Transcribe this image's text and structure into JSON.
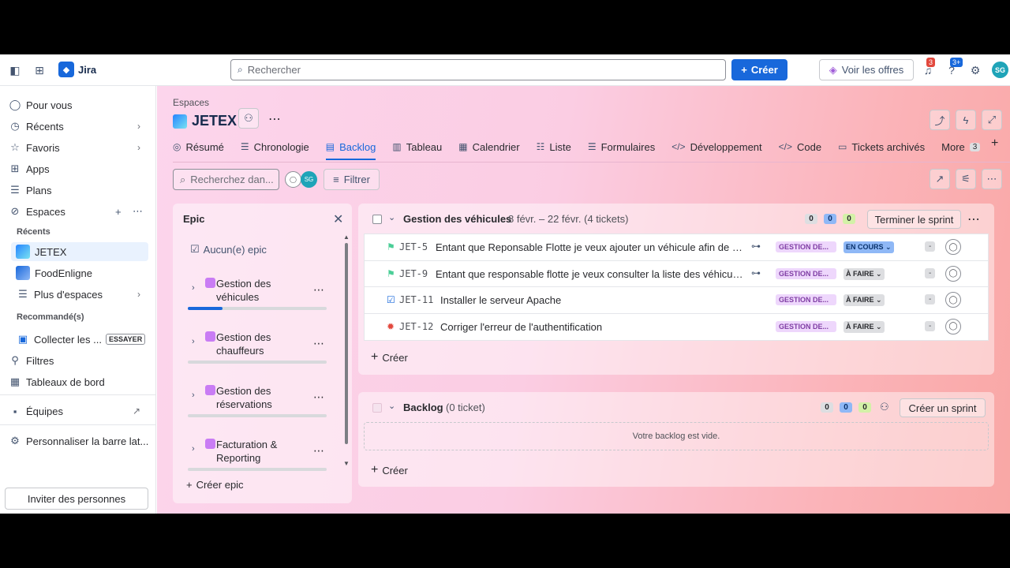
{
  "topbar": {
    "app_name": "Jira",
    "search_placeholder": "Rechercher",
    "create_label": "Créer",
    "offers_label": "Voir les offres",
    "notif_count": "3",
    "help_count": "3+",
    "avatar_initials": "SG"
  },
  "sidebar": {
    "for_you": "Pour vous",
    "recent": "Récents",
    "favorites": "Favoris",
    "apps": "Apps",
    "plans": "Plans",
    "spaces": "Espaces",
    "recent_section": "Récents",
    "project1": "JETEX",
    "project2": "FoodEnligne",
    "more_spaces": "Plus d'espaces",
    "recommended_section": "Recommandé(s)",
    "collect": "Collecter les ...",
    "try_badge": "ESSAYER",
    "filters": "Filtres",
    "dashboards": "Tableaux de bord",
    "teams": "Équipes",
    "customize": "Personnaliser la barre lat...",
    "invite": "Inviter des personnes"
  },
  "header": {
    "breadcrumb": "Espaces",
    "project_name": "JETEX"
  },
  "tabs": [
    {
      "label": "Résumé",
      "icon": "globe-icon",
      "glyph": "◎"
    },
    {
      "label": "Chronologie",
      "icon": "timeline-icon",
      "glyph": "☰"
    },
    {
      "label": "Backlog",
      "icon": "backlog-icon",
      "glyph": "▤"
    },
    {
      "label": "Tableau",
      "icon": "board-icon",
      "glyph": "▥"
    },
    {
      "label": "Calendrier",
      "icon": "calendar-icon",
      "glyph": "▦"
    },
    {
      "label": "Liste",
      "icon": "list-icon",
      "glyph": "☷"
    },
    {
      "label": "Formulaires",
      "icon": "forms-icon",
      "glyph": "☰"
    },
    {
      "label": "Développement",
      "icon": "code-icon",
      "glyph": "</>"
    },
    {
      "label": "Code",
      "icon": "code-icon",
      "glyph": "</>"
    },
    {
      "label": "Tickets archivés",
      "icon": "archive-icon",
      "glyph": "▭"
    },
    {
      "label": "More",
      "icon": "",
      "glyph": ""
    }
  ],
  "more_count": "3",
  "toolbar": {
    "search_placeholder": "Recherchez dan...",
    "avatar_initials": "SG",
    "filter_label": "Filtrer"
  },
  "epic_panel": {
    "title": "Epic",
    "none_label": "Aucun(e) epic",
    "items": [
      {
        "line1": "Gestion des",
        "line2": "véhicules",
        "progress": 0.25
      },
      {
        "line1": "Gestion des",
        "line2": "chauffeurs",
        "progress": 0
      },
      {
        "line1": "Gestion des",
        "line2": "réservations",
        "progress": 0
      },
      {
        "line1": "Facturation &",
        "line2": "Reporting",
        "progress": 0
      }
    ],
    "create_label": "Créer epic"
  },
  "sprint": {
    "name": "Gestion des véhicules",
    "dates": "8 févr. – 22 févr. (4 tickets)",
    "counts": [
      "0",
      "0",
      "0"
    ],
    "complete_label": "Terminer le sprint",
    "create_label": "Créer",
    "issues": [
      {
        "type": "story",
        "key": "JET-5",
        "summary": "Entant que Reponsable Flotte je veux ajouter un véhicule afin de sui...",
        "has_child": true,
        "epic": "GESTION DE...",
        "status": "EN COURS",
        "status_kind": "prog",
        "estimate": "-"
      },
      {
        "type": "story",
        "key": "JET-9",
        "summary": "Entant que responsable flotte je veux consulter la liste des véhicule ...",
        "has_child": true,
        "epic": "GESTION DE...",
        "status": "À FAIRE",
        "status_kind": "todo",
        "estimate": "-"
      },
      {
        "type": "task",
        "key": "JET-11",
        "summary": "Installer le serveur Apache",
        "has_child": false,
        "epic": "GESTION DE...",
        "status": "À FAIRE",
        "status_kind": "todo",
        "estimate": "-"
      },
      {
        "type": "bug",
        "key": "JET-12",
        "summary": "Corriger l'erreur de l'authentification",
        "has_child": false,
        "epic": "GESTION DE...",
        "status": "À FAIRE",
        "status_kind": "todo",
        "estimate": "-"
      }
    ]
  },
  "backlog": {
    "name": "Backlog",
    "sub": "(0 ticket)",
    "counts": [
      "0",
      "0",
      "0"
    ],
    "create_sprint_label": "Créer un sprint",
    "empty_text": "Votre backlog est vide.",
    "create_label": "Créer"
  }
}
